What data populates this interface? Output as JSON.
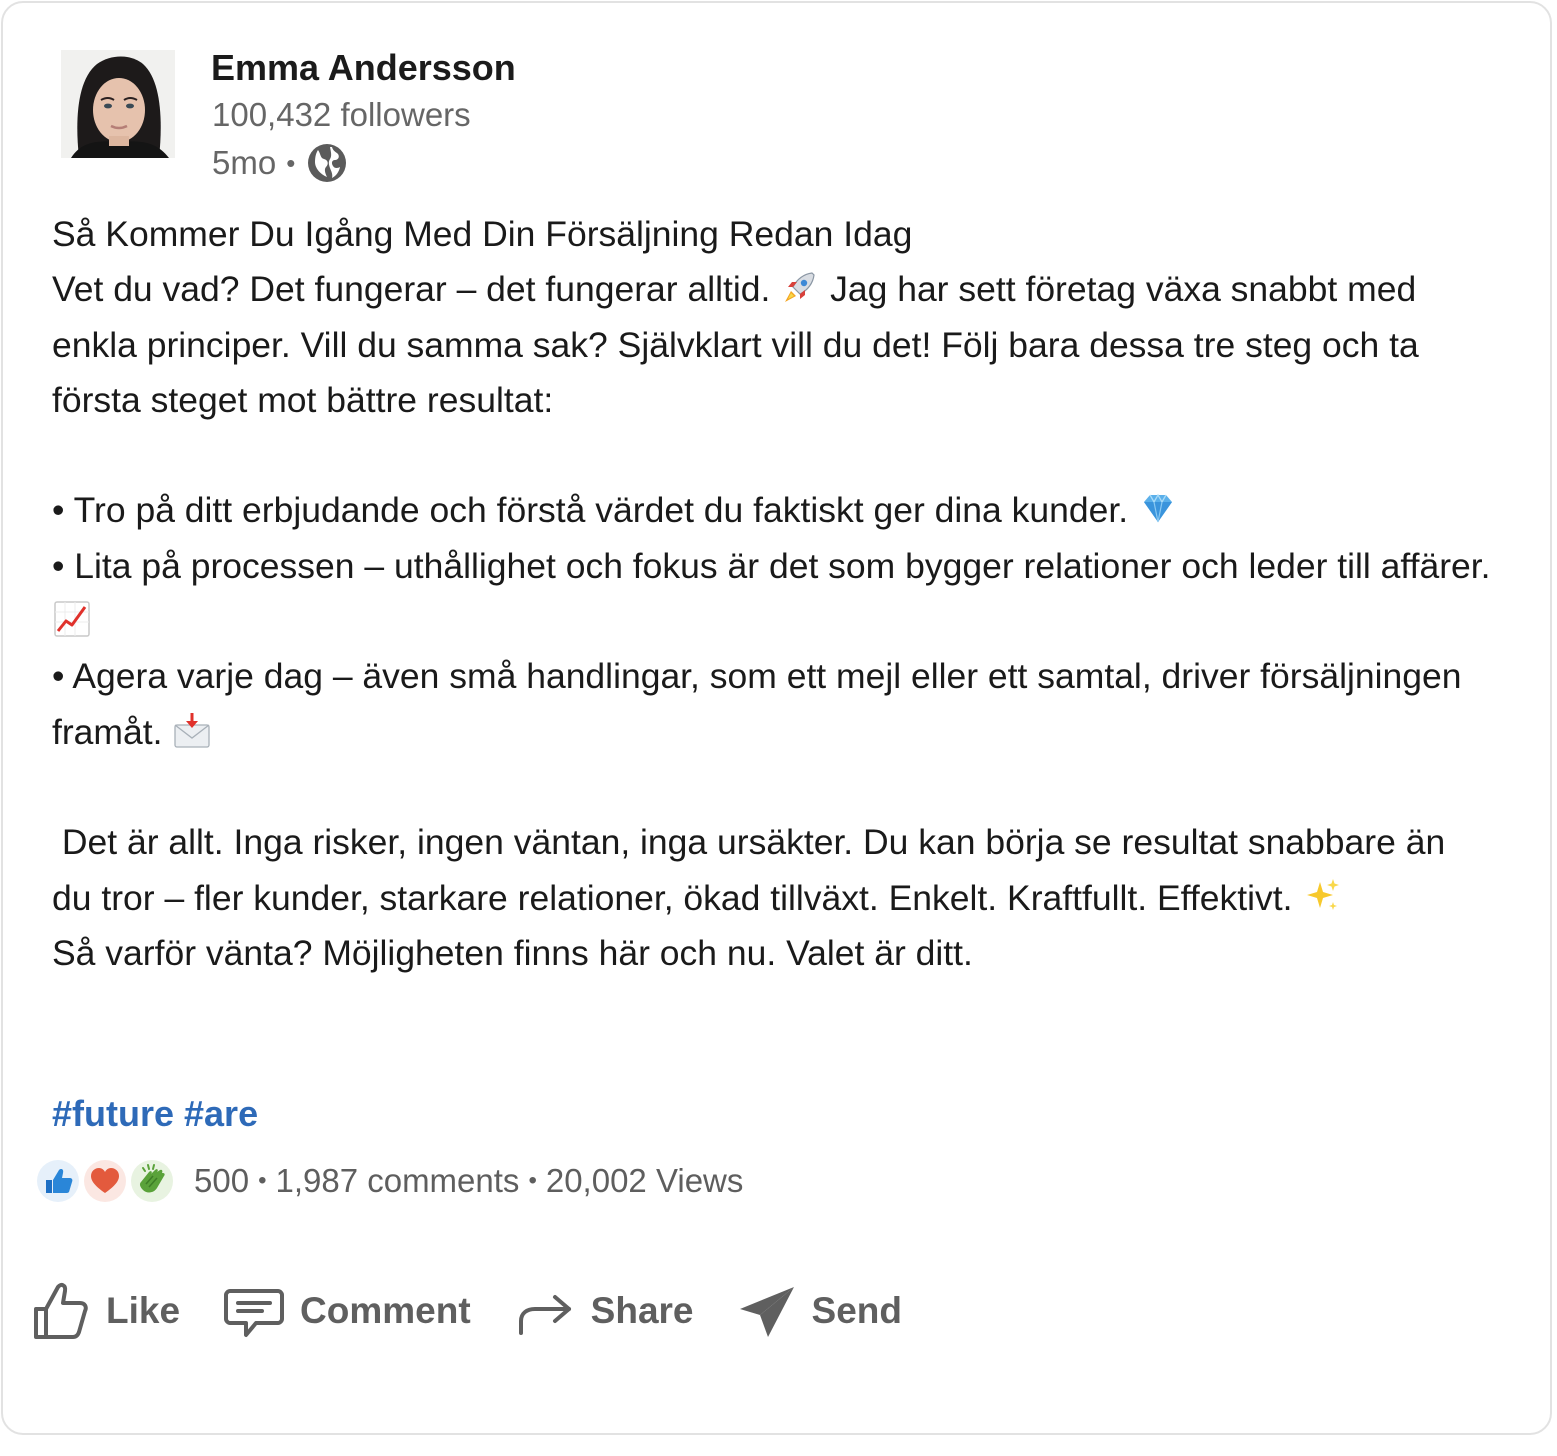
{
  "author": {
    "name": "Emma Andersson",
    "followers": "100,432 followers",
    "time": "5mo",
    "visibility_icon": "globe-icon"
  },
  "post": {
    "title": "Så Kommer Du Igång Med Din Försäljning Redan Idag",
    "intro_a": "Vet du vad? Det fungerar – det fungerar alltid.",
    "intro_a_emoji": "rocket-emoji",
    "intro_b": " Jag har sett företag växa snabbt med enkla principer. Vill du samma sak? Självklart vill du det! Följ bara dessa tre steg och ta första steget mot bättre resultat:",
    "bullet1": "• Tro på ditt erbjudande och förstå värdet du faktiskt ger dina kunder.",
    "bullet1_emoji": "gem-emoji",
    "bullet2": "• Lita på processen – uthållighet och fokus är det som bygger relationer och leder till affärer.",
    "bullet2_emoji": "chart-increasing-emoji",
    "bullet3": "• Agera varje dag – även små handlingar, som ett mejl eller ett samtal, driver försäljningen framåt.",
    "bullet3_emoji": "envelope-arrow-emoji",
    "closing": " Det är allt. Inga risker, ingen väntan, inga ursäkter. Du kan börja se resultat snabbare än du tror – fler kunder, starkare relationer, ökad tillväxt. Enkelt. Kraftfullt. Effektivt.",
    "closing_emoji": "sparkles-emoji",
    "final": "Så varför vänta? Möjligheten finns här och nu. Valet är ditt.",
    "hashtags": [
      "#future",
      "#are"
    ]
  },
  "engagement": {
    "reaction_icons": [
      "like-reaction-icon",
      "love-reaction-icon",
      "clap-reaction-icon"
    ],
    "reactions": "500",
    "comments": "1,987 comments",
    "views": "20,002 Views",
    "separator": "•"
  },
  "actions": {
    "like": "Like",
    "comment": "Comment",
    "share": "Share",
    "send": "Send"
  },
  "colors": {
    "hashtag": "#2e6ab8",
    "muted_text": "#666666",
    "action_text": "#5f5f5f",
    "border": "#e2e2e2"
  }
}
